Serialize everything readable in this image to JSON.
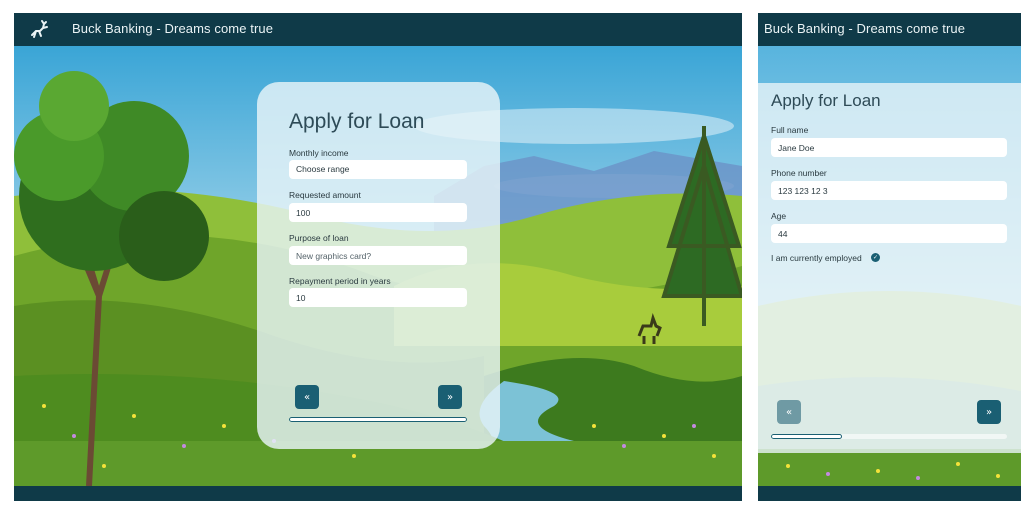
{
  "app": {
    "title": "Buck Banking - Dreams come true"
  },
  "colors": {
    "bar": "#0f3a48",
    "accent": "#1a5f73",
    "card": "#e8f4f8"
  },
  "form1": {
    "heading": "Apply for Loan",
    "income": {
      "label": "Monthly income",
      "value": "Choose range"
    },
    "amount": {
      "label": "Requested amount",
      "value": "100"
    },
    "purpose": {
      "label": "Purpose of loan",
      "placeholder": "New graphics card?"
    },
    "period": {
      "label": "Repayment period in years",
      "value": "10"
    },
    "prev_label": "«",
    "next_label": "»",
    "progress": 1.0
  },
  "form2": {
    "heading": "Apply for Loan",
    "name": {
      "label": "Full name",
      "value": "Jane Doe"
    },
    "phone": {
      "label": "Phone number",
      "value": "123 123 12 3"
    },
    "age": {
      "label": "Age",
      "value": "44"
    },
    "employed": {
      "label": "I am currently employed",
      "checked": true
    },
    "prev_label": "«",
    "next_label": "»",
    "progress": 0.3
  }
}
